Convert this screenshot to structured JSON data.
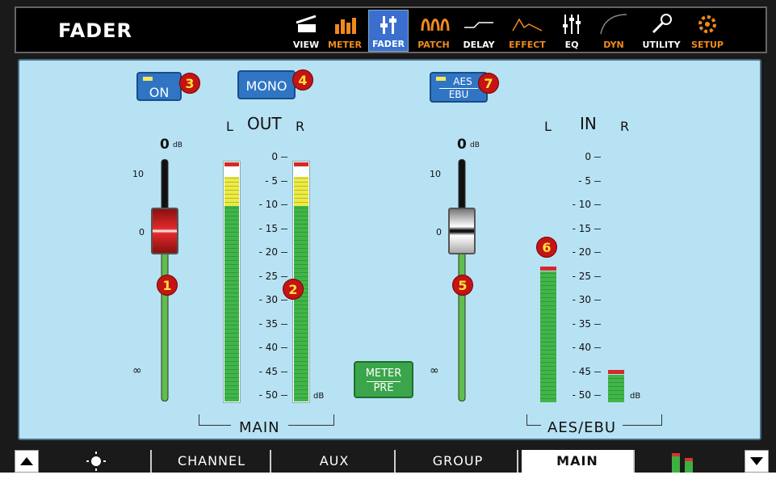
{
  "header": {
    "title": "FADER",
    "nav": [
      {
        "id": "view",
        "label": "VIEW",
        "color": "#ffffff"
      },
      {
        "id": "meter",
        "label": "METER",
        "color": "#f08a1e"
      },
      {
        "id": "fader",
        "label": "FADER",
        "color": "#ffffff"
      },
      {
        "id": "patch",
        "label": "PATCH",
        "color": "#f08a1e"
      },
      {
        "id": "delay",
        "label": "DELAY",
        "color": "#ffffff"
      },
      {
        "id": "effect",
        "label": "EFFECT",
        "color": "#f08a1e"
      },
      {
        "id": "eq",
        "label": "EQ",
        "color": "#ffffff"
      },
      {
        "id": "dyn",
        "label": "DYN",
        "color": "#f08a1e"
      },
      {
        "id": "utility",
        "label": "UTILITY",
        "color": "#ffffff"
      },
      {
        "id": "setup",
        "label": "SETUP",
        "color": "#f08a1e"
      }
    ],
    "active": "fader"
  },
  "main": {
    "on_button": "ON",
    "mono_button": "MONO",
    "out_label": "OUT",
    "l": "L",
    "r": "R",
    "fader_scale": {
      "zero": "0",
      "db": "dB",
      "plus10": "10",
      "unity": "0",
      "inf": "∞"
    },
    "meter_scale": [
      "0",
      "- 5",
      "- 10",
      "- 15",
      "- 20",
      "- 25",
      "- 30",
      "- 35",
      "- 40",
      "- 45",
      "- 50"
    ],
    "db_unit": "dB",
    "main_label": "MAIN",
    "meter_pre": "METER\nPRE",
    "meter_pre_top": "METER",
    "meter_pre_bottom": "PRE",
    "aes_top": "AES",
    "aes_bottom": "EBU",
    "in_label": "IN",
    "aes_ebu_label": "AES/EBU"
  },
  "badges": [
    "1",
    "2",
    "3",
    "4",
    "5",
    "6",
    "7"
  ],
  "levels": {
    "main_fader_db": 0,
    "aes_fader_db": 0,
    "out_l_db": -1,
    "out_r_db": -1,
    "in_l_db": -23,
    "in_r_db": -43
  },
  "footer": {
    "tabs": [
      "CHANNEL",
      "AUX",
      "GROUP",
      "MAIN"
    ],
    "active_tab": "MAIN"
  },
  "colors": {
    "panel": "#b7e2f4",
    "button_blue": "#2f75c4",
    "meter_green": "#41b54a",
    "meter_yellow": "#ecec45",
    "fader_red": "#d41f1f",
    "badge_red": "#c41414",
    "accent_orange": "#f08a1e"
  }
}
